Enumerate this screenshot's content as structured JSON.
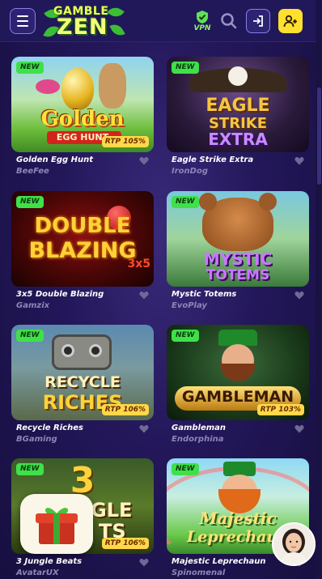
{
  "header": {
    "logo_top": "GAMBLE",
    "logo_bottom": "ZEN",
    "vpn_label": "VPN",
    "icons": {
      "menu": "menu-icon",
      "vpn": "shield-check-icon",
      "search": "search-icon",
      "login": "login-icon",
      "signup": "add-user-icon"
    }
  },
  "colors": {
    "new_badge": "#3fe04a",
    "rtp_badge": "#ffd84a",
    "signup": "#ffe02e",
    "background": "#23175a"
  },
  "games": [
    {
      "art_line1": "Golden",
      "art_line2": "EGG HUNT",
      "name": "Golden Egg Hunt",
      "provider": "BeeFee",
      "new": "NEW",
      "rtp": "RTP 105%"
    },
    {
      "art_line1": "EAGLE",
      "art_line2": "STRIKE",
      "art_line3": "EXTRA",
      "name": "Eagle Strike Extra",
      "provider": "IronDog",
      "new": "NEW",
      "rtp": ""
    },
    {
      "art_line1": "DOUBLE",
      "art_line2": "BLAZING",
      "art_line3": "3x5",
      "name": "3x5 Double Blazing",
      "provider": "Gamzix",
      "new": "NEW",
      "rtp": ""
    },
    {
      "art_line1": "MYSTIC",
      "art_line2": "TOTEMS",
      "name": "Mystic Totems",
      "provider": "EvoPlay",
      "new": "NEW",
      "rtp": ""
    },
    {
      "art_line1": "RECYCLE",
      "art_line2": "RICHES",
      "name": "Recycle Riches",
      "provider": "BGaming",
      "new": "NEW",
      "rtp": "RTP 106%"
    },
    {
      "art_line1": "GAMBLEMAN",
      "name": "Gambleman",
      "provider": "Endorphina",
      "new": "NEW",
      "rtp": "RTP 103%"
    },
    {
      "art_line1": "3",
      "art_line2": "GLE",
      "art_line3": "TS",
      "name": "3 Jungle Beats",
      "provider": "AvatarUX",
      "new": "NEW",
      "rtp": "RTP 106%"
    },
    {
      "art_line1": "Majestic",
      "art_line2": "Leprechaun",
      "name": "Majestic Leprechaun",
      "provider": "Spinomenal",
      "new": "NEW",
      "rtp": ""
    }
  ]
}
